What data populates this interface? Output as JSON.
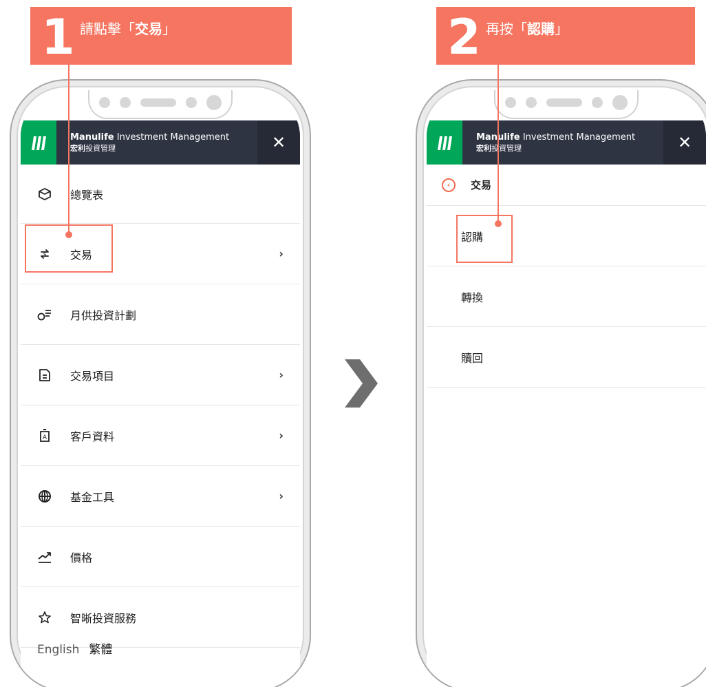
{
  "step1": {
    "number": "1",
    "text_prefix": "請點擊「",
    "text_bold": "交易",
    "text_suffix": "」"
  },
  "step2": {
    "number": "2",
    "text_prefix": "再按「",
    "text_bold": "認購",
    "text_suffix": "」"
  },
  "header": {
    "brand_bold": "Manulife",
    "brand_rest": " Investment Management",
    "brand_zh_bold": "宏利",
    "brand_zh_rest": "投資管理",
    "close": "✕"
  },
  "menu": {
    "items": [
      {
        "label": "總覽表",
        "icon": "cube-icon",
        "chevron": ""
      },
      {
        "label": "交易",
        "icon": "exchange-icon",
        "chevron": "›"
      },
      {
        "label": "月供投資計劃",
        "icon": "plan-icon",
        "chevron": ""
      },
      {
        "label": "交易項目",
        "icon": "document-icon",
        "chevron": "›"
      },
      {
        "label": "客戶資料",
        "icon": "profile-icon",
        "chevron": "›"
      },
      {
        "label": "基金工具",
        "icon": "globe-icon",
        "chevron": "›"
      },
      {
        "label": "價格",
        "icon": "trend-icon",
        "chevron": ""
      },
      {
        "label": "智晰投資服務",
        "icon": "star-icon",
        "chevron": ""
      }
    ],
    "lang_en": "English",
    "lang_zh": "繁體"
  },
  "submenu": {
    "title": "交易",
    "back": "‹",
    "items": [
      "認購",
      "轉換",
      "贖回"
    ]
  },
  "colors": {
    "accent": "#f57560",
    "appbar": "#2f3443",
    "logo": "#00a758"
  }
}
